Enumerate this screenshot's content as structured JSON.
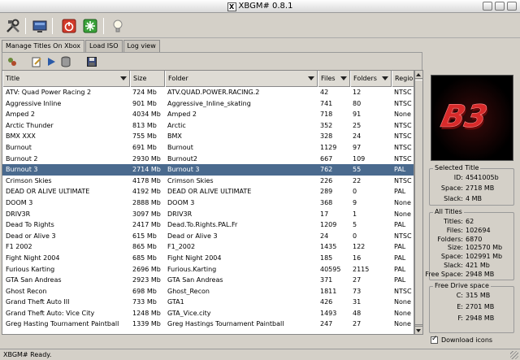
{
  "window": {
    "title": "XBGM# 0.8.1"
  },
  "toolbar": {
    "icons": [
      "tools-icon",
      "monitor-icon",
      "power-icon",
      "recycle-icon",
      "lightbulb-icon"
    ]
  },
  "tabs": [
    {
      "label": "Manage Titles On Xbox",
      "active": true
    },
    {
      "label": "Load ISO",
      "active": false
    },
    {
      "label": "Log view",
      "active": false
    }
  ],
  "subtoolbar": {
    "icons": [
      "refresh-icon",
      "edit-icon",
      "play-icon",
      "database-icon",
      "save-icon"
    ]
  },
  "table": {
    "columns": [
      "Title",
      "Size",
      "Folder",
      "Files",
      "Folders",
      "Regio"
    ],
    "rows": [
      [
        "ATV: Quad Power Racing 2",
        "724 Mb",
        "ATV.QUAD.POWER.RACING.2",
        "42",
        "12",
        "NTSC"
      ],
      [
        "Aggressive Inline",
        "901 Mb",
        "Aggressive_Inline_skating",
        "741",
        "80",
        "NTSC"
      ],
      [
        "Amped 2",
        "4034 Mb",
        "Amped 2",
        "718",
        "91",
        "None"
      ],
      [
        "Arctic Thunder",
        "813 Mb",
        "Arctic",
        "352",
        "25",
        "NTSC"
      ],
      [
        "BMX XXX",
        "755 Mb",
        "BMX",
        "328",
        "24",
        "NTSC"
      ],
      [
        "Burnout",
        "691 Mb",
        "Burnout",
        "1129",
        "97",
        "NTSC"
      ],
      [
        "Burnout 2",
        "2930 Mb",
        "Burnout2",
        "667",
        "109",
        "NTSC"
      ],
      [
        "Burnout 3",
        "2714 Mb",
        "Burnout 3",
        "762",
        "55",
        "PAL"
      ],
      [
        "Crimson Skies",
        "4178 Mb",
        "Crimson Skies",
        "226",
        "22",
        "NTSC"
      ],
      [
        "DEAD OR ALIVE ULTIMATE",
        "4192 Mb",
        "DEAD OR ALIVE ULTIMATE",
        "289",
        "0",
        "PAL"
      ],
      [
        "DOOM 3",
        "2888 Mb",
        "DOOM 3",
        "368",
        "9",
        "None"
      ],
      [
        "DRIV3R",
        "3097 Mb",
        "DRIV3R",
        "17",
        "1",
        "None"
      ],
      [
        "Dead To Rights",
        "2417 Mb",
        "Dead.To.Rights.PAL.Fr",
        "1209",
        "5",
        "PAL"
      ],
      [
        "Dead or Alive 3",
        "615 Mb",
        "Dead or Alive 3",
        "24",
        "0",
        "NTSC"
      ],
      [
        "F1 2002",
        "865 Mb",
        "F1_2002",
        "1435",
        "122",
        "PAL"
      ],
      [
        "Fight Night 2004",
        "685 Mb",
        "Fight Night 2004",
        "185",
        "16",
        "PAL"
      ],
      [
        "Furious Karting",
        "2696 Mb",
        "Furious.Karting",
        "40595",
        "2115",
        "PAL"
      ],
      [
        "GTA San Andreas",
        "2923 Mb",
        "GTA San Andreas",
        "371",
        "27",
        "PAL"
      ],
      [
        "Ghost Recon",
        "698 Mb",
        "Ghost_Recon",
        "1811",
        "73",
        "NTSC"
      ],
      [
        "Grand Theft Auto III",
        "733 Mb",
        "GTA1",
        "426",
        "31",
        "None"
      ],
      [
        "Grand Theft Auto: Vice City",
        "1248 Mb",
        "GTA_Vice.city",
        "1493",
        "48",
        "None"
      ],
      [
        "Greg Hasting Tournament Paintball",
        "1339 Mb",
        "Greg Hastings Tournament Paintball",
        "247",
        "27",
        "None"
      ]
    ],
    "selected_index": 7
  },
  "selected_title": {
    "legend": "Selected Title",
    "id_label": "ID:",
    "id": "4541005b",
    "space_label": "Space:",
    "space": "2718 MB",
    "slack_label": "Slack:",
    "slack": "4 MB"
  },
  "all_titles": {
    "legend": "All Titles",
    "rows": [
      {
        "label": "Titles:",
        "value": "62"
      },
      {
        "label": "Files:",
        "value": "102694"
      },
      {
        "label": "Folders:",
        "value": "6870"
      },
      {
        "label": "Size:",
        "value": "102570 Mb"
      },
      {
        "label": "Space:",
        "value": "102991 Mb"
      },
      {
        "label": "Slack:",
        "value": "421 Mb"
      },
      {
        "label": "Free Space:",
        "value": "2948 MB"
      }
    ]
  },
  "free_drive": {
    "legend": "Free Drive space",
    "rows": [
      {
        "label": "C:",
        "value": "315 MB"
      },
      {
        "label": "E:",
        "value": "2701 MB"
      },
      {
        "label": "F:",
        "value": "2948 MB"
      }
    ]
  },
  "download_icons": {
    "label": "Download icons",
    "checked": true
  },
  "cover": {
    "text": "B3"
  },
  "status": {
    "text": "XBGM# Ready."
  }
}
